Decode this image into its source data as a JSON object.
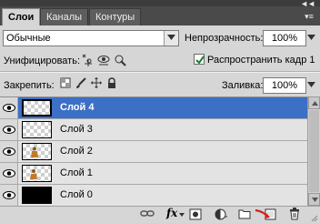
{
  "tabs": [
    {
      "label": "Слои",
      "active": true
    },
    {
      "label": "Каналы",
      "active": false
    },
    {
      "label": "Контуры",
      "active": false
    }
  ],
  "blend": {
    "value": "Обычные"
  },
  "opacity": {
    "label": "Непрозрачность:",
    "value": "100%"
  },
  "unify": {
    "label": "Унифицировать:"
  },
  "propagate": {
    "label": "Распространить кадр 1",
    "checked": true
  },
  "lock": {
    "label": "Закрепить:"
  },
  "fill": {
    "label": "Заливка:",
    "value": "100%"
  },
  "layers": [
    {
      "name": "Слой 4",
      "selected": true,
      "thumb": "transparent"
    },
    {
      "name": "Слой 3",
      "selected": false,
      "thumb": "transparent"
    },
    {
      "name": "Слой 2",
      "selected": false,
      "thumb": "figure"
    },
    {
      "name": "Слой 1",
      "selected": false,
      "thumb": "figure"
    },
    {
      "name": "Слой 0",
      "selected": false,
      "thumb": "black"
    }
  ],
  "bottom": {
    "fx_label": "fx"
  },
  "colors": {
    "selection": "#3c6fc6",
    "tab_bar": "#4a4a4a",
    "panel": "#d6d6d6"
  }
}
